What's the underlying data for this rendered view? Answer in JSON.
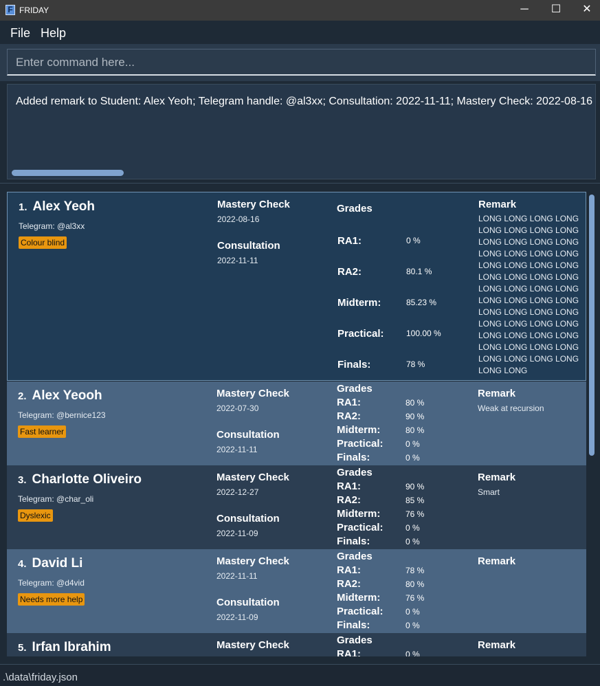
{
  "window": {
    "title": "FRIDAY",
    "app_icon": "F",
    "minimize_glyph": "─",
    "maximize_glyph": "☐",
    "close_glyph": "✕"
  },
  "menu": {
    "file": "File",
    "help": "Help"
  },
  "command": {
    "placeholder": "Enter command here..."
  },
  "result": {
    "text": "Added remark to Student: Alex Yeoh; Telegram handle: @al3xx; Consultation: 2022-11-11; Mastery Check: 2022-08-16"
  },
  "labels": {
    "mastery_check": "Mastery Check",
    "consultation": "Consultation",
    "grades": "Grades",
    "remark": "Remark",
    "ra1": "RA1:",
    "ra2": "RA2:",
    "midterm": "Midterm:",
    "practical": "Practical:",
    "finals": "Finals:"
  },
  "students": [
    {
      "index": "1.",
      "name": "Alex Yeoh",
      "telegram": "Telegram: @al3xx",
      "tag": "Colour blind",
      "mastery_check": "2022-08-16",
      "consultation": "2022-11-11",
      "grades": {
        "ra1": "0 %",
        "ra2": "80.1 %",
        "midterm": "85.23 %",
        "practical": "100.00 %",
        "finals": "78 %"
      },
      "remark": "LONG LONG LONG LONG LONG LONG LONG LONG LONG LONG LONG LONG LONG LONG LONG LONG LONG LONG LONG LONG LONG LONG LONG LONG LONG LONG LONG LONG LONG LONG LONG LONG LONG LONG LONG LONG LONG LONG LONG LONG LONG LONG LONG LONG LONG LONG LONG LONG LONG LONG LONG LONG LONG LONG"
    },
    {
      "index": "2.",
      "name": "Alex Yeooh",
      "telegram": "Telegram: @bernice123",
      "tag": "Fast learner",
      "mastery_check": "2022-07-30",
      "consultation": "2022-11-11",
      "grades": {
        "ra1": "80 %",
        "ra2": "90 %",
        "midterm": "80 %",
        "practical": "0 %",
        "finals": "0 %"
      },
      "remark": "Weak at recursion"
    },
    {
      "index": "3.",
      "name": "Charlotte Oliveiro",
      "telegram": "Telegram: @char_oli",
      "tag": "Dyslexic",
      "mastery_check": "2022-12-27",
      "consultation": "2022-11-09",
      "grades": {
        "ra1": "90 %",
        "ra2": "85 %",
        "midterm": "76 %",
        "practical": "0 %",
        "finals": "0 %"
      },
      "remark": "Smart"
    },
    {
      "index": "4.",
      "name": "David Li",
      "telegram": "Telegram: @d4vid",
      "tag": "Needs more help",
      "mastery_check": "2022-11-11",
      "consultation": "2022-11-09",
      "grades": {
        "ra1": "78 %",
        "ra2": "80 %",
        "midterm": "76 %",
        "practical": "0 %",
        "finals": "0 %"
      },
      "remark": ""
    },
    {
      "index": "5.",
      "name": "Irfan Ibrahim",
      "grades": {
        "ra1": "0 %"
      }
    }
  ],
  "status": {
    "path": ".\\data\\friday.json"
  }
}
